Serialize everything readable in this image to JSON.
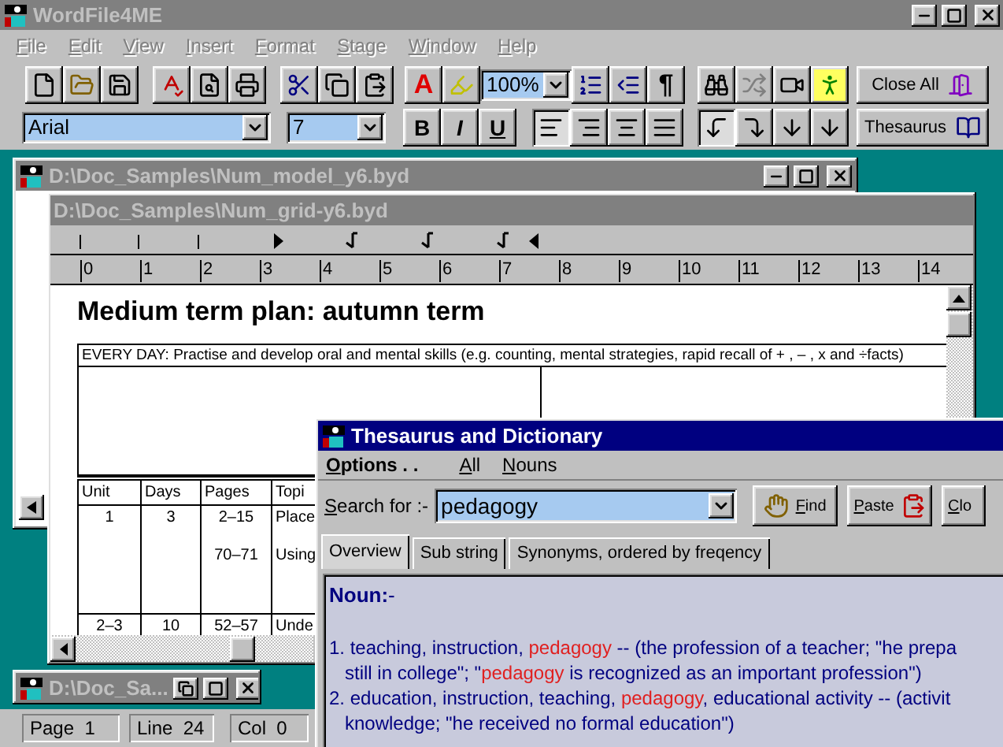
{
  "main_window": {
    "title": "WordFile4ME"
  },
  "menu": [
    "File",
    "Edit",
    "View",
    "Insert",
    "Format",
    "Stage",
    "Window",
    "Help"
  ],
  "toolbar": {
    "font_color": "A",
    "zoom": "100%",
    "paragraph": "¶",
    "close_all": "Close All",
    "font": "Arial",
    "size": "7",
    "format": [
      "B",
      "I",
      "U"
    ],
    "alignment": [
      {
        "selected": true
      },
      {
        "selected": false
      },
      {
        "selected": false
      },
      {
        "selected": false
      }
    ],
    "spacing": [
      {
        "selected": true
      },
      {
        "selected": false
      },
      {
        "selected": false
      },
      {
        "selected": false
      }
    ],
    "thesaurus": "Thesaurus"
  },
  "model_window": {
    "title": "D:\\Doc_Samples\\Num_model_y6.byd"
  },
  "grid_window": {
    "title": "D:\\Doc_Samples\\Num_grid-y6.byd",
    "ruler": [
      "0",
      "1",
      "2",
      "3",
      "4",
      "5",
      "6",
      "7",
      "8",
      "9",
      "10",
      "11",
      "12",
      "13",
      "14"
    ],
    "heading": "Medium term plan: autumn term",
    "every_day": "EVERY DAY: Practise and develop oral and mental skills (e.g. counting, mental strategies, rapid recall of + , – , x and ÷facts)",
    "table": {
      "columns": [
        "Unit",
        "Days",
        "Pages",
        "Topi"
      ],
      "rows": [
        [
          [
            "1"
          ],
          [
            "3"
          ],
          [
            "2–15",
            "70–71"
          ],
          [
            "Place",
            "Using"
          ]
        ],
        [
          [
            "2–3"
          ],
          [
            "10"
          ],
          [
            "52–57"
          ],
          [
            "Unde"
          ]
        ]
      ]
    }
  },
  "minimized_window": {
    "title": "D:\\Doc_Sa..."
  },
  "status_bar": [
    "Page  1",
    "Line  24",
    "Col  0"
  ],
  "dialog": {
    "title": "Thesaurus and Dictionary",
    "menu": [
      {
        "label": "Options . .",
        "kind": "main"
      },
      {
        "label": "All",
        "kind": "filter"
      },
      {
        "label": "Nouns",
        "kind": "filter"
      }
    ],
    "search_label": "Search for :-",
    "search_value": "pedagogy",
    "buttons": [
      "Find",
      "Paste",
      "Clo"
    ],
    "tabs": [
      {
        "label": "Overview",
        "selected": true
      },
      {
        "label": "Sub string",
        "selected": false
      },
      {
        "label": "Synonyms, ordered by freqency",
        "selected": false
      }
    ],
    "heading": "**Noun:**-",
    "lines": [
      {
        "kind": "first",
        "segments": [
          {
            "text": "1. teaching, instruction, ",
            "highlight": false
          },
          {
            "text": "pedagogy",
            "highlight": true
          },
          {
            "text": " -- (the profession of a teacher; \"he prepa",
            "highlight": false
          }
        ]
      },
      {
        "kind": "continuation",
        "segments": [
          {
            "text": "still in college\"; \"",
            "highlight": false
          },
          {
            "text": "pedagogy",
            "highlight": true
          },
          {
            "text": " is recognized as an important profession\")",
            "highlight": false
          }
        ]
      },
      {
        "kind": "first",
        "segments": [
          {
            "text": "2. education, instruction, teaching, ",
            "highlight": false
          },
          {
            "text": "pedagogy",
            "highlight": true
          },
          {
            "text": ", educational activity -- (activit",
            "highlight": false
          }
        ]
      },
      {
        "kind": "continuation",
        "segments": [
          {
            "text": "knowledge; \"he received no formal education\")",
            "highlight": false
          }
        ]
      }
    ]
  }
}
